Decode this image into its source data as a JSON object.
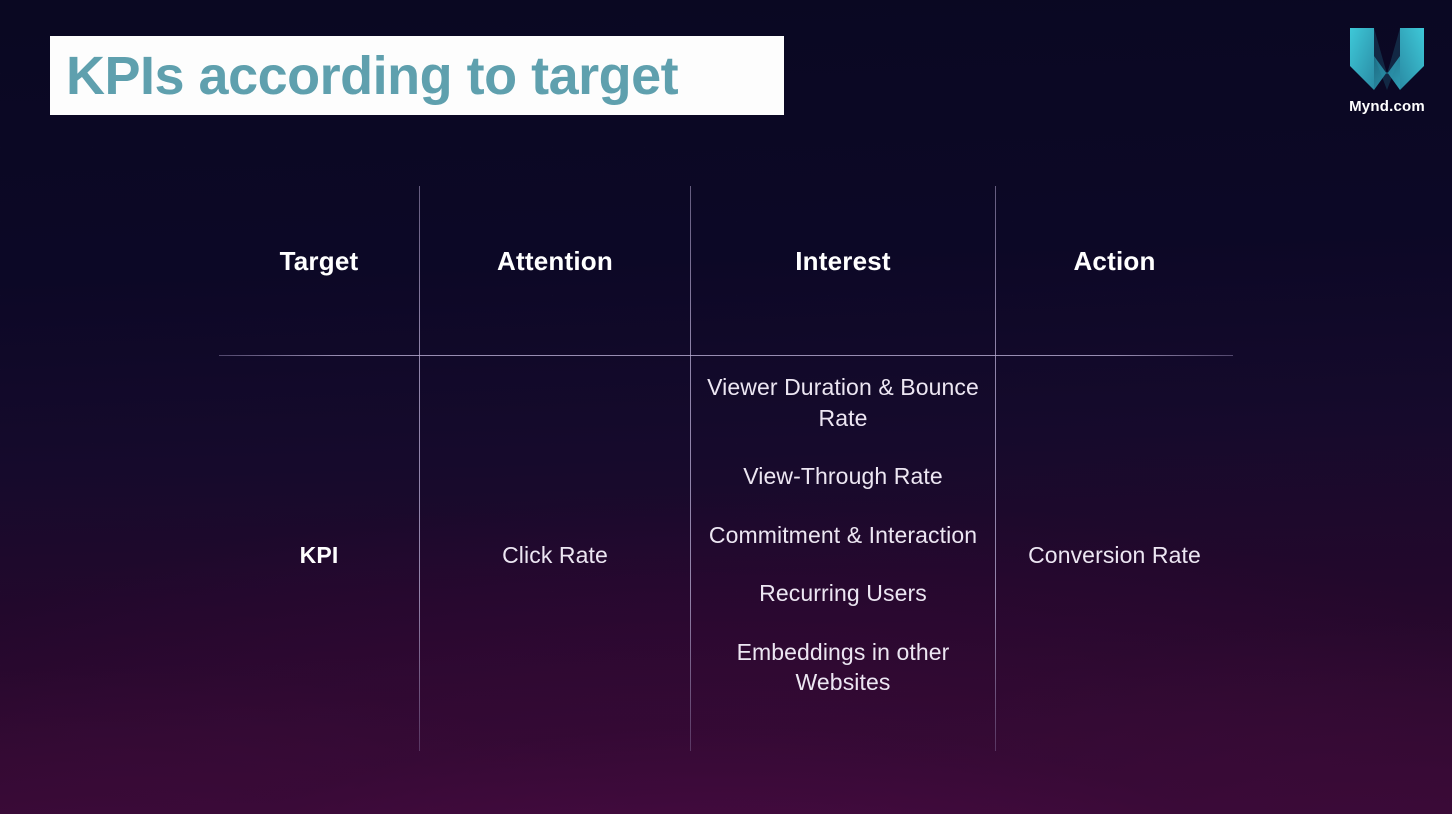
{
  "slide": {
    "title": "KPIs according to target",
    "title_color": "#5fa0ae",
    "title_box_color": "#fdfdfd",
    "background_top_color": "#0a0822",
    "background_bottom_color": "#330b31"
  },
  "brand": {
    "logo_icon": "mynd-m-logo-icon",
    "name": "Mynd.com",
    "logo_color_light": "#3ec8d8",
    "logo_color_mid": "#2b8fa6",
    "logo_color_dark": "#1f6f86"
  },
  "table": {
    "headers": [
      {
        "label": "Target"
      },
      {
        "label": "Attention"
      },
      {
        "label": "Interest"
      },
      {
        "label": "Action"
      }
    ],
    "rows": [
      {
        "label": "KPI",
        "attention": "Click Rate",
        "interest": [
          "Viewer Duration & Bounce Rate",
          "View-Through Rate",
          "Commitment & Interaction",
          "Recurring Users",
          "Embeddings in other Websites"
        ],
        "action": "Conversion Rate"
      }
    ]
  }
}
